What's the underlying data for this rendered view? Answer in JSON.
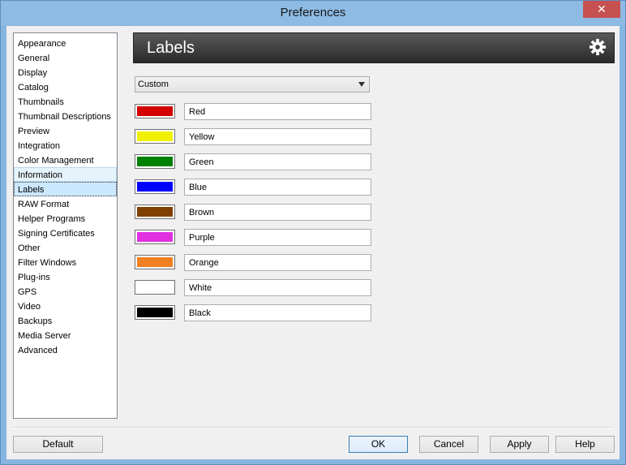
{
  "window": {
    "title": "Preferences",
    "close_label": "✕"
  },
  "sidebar": {
    "items": [
      {
        "label": "Appearance"
      },
      {
        "label": "General"
      },
      {
        "label": "Display"
      },
      {
        "label": "Catalog"
      },
      {
        "label": "Thumbnails"
      },
      {
        "label": "Thumbnail Descriptions"
      },
      {
        "label": "Preview"
      },
      {
        "label": "Integration"
      },
      {
        "label": "Color Management"
      },
      {
        "label": "Information"
      },
      {
        "label": "Labels"
      },
      {
        "label": "RAW Format"
      },
      {
        "label": "Helper Programs"
      },
      {
        "label": "Signing Certificates"
      },
      {
        "label": "Other"
      },
      {
        "label": "Filter Windows"
      },
      {
        "label": "Plug-ins"
      },
      {
        "label": "GPS"
      },
      {
        "label": "Video"
      },
      {
        "label": "Backups"
      },
      {
        "label": "Media Server"
      },
      {
        "label": "Advanced"
      }
    ],
    "selected": "Labels",
    "hovered": "Information"
  },
  "panel": {
    "title": "Labels",
    "icon": "gear-icon",
    "preset": {
      "selected": "Custom"
    },
    "labels": [
      {
        "name": "Red",
        "color": "#d40000"
      },
      {
        "name": "Yellow",
        "color": "#f0f000"
      },
      {
        "name": "Green",
        "color": "#008000"
      },
      {
        "name": "Blue",
        "color": "#0000ff"
      },
      {
        "name": "Brown",
        "color": "#804000"
      },
      {
        "name": "Purple",
        "color": "#e030e0"
      },
      {
        "name": "Orange",
        "color": "#f08020"
      },
      {
        "name": "White",
        "color": "#ffffff"
      },
      {
        "name": "Black",
        "color": "#000000"
      }
    ]
  },
  "buttons": {
    "default_label": "Default",
    "ok_label": "OK",
    "cancel_label": "Cancel",
    "apply_label": "Apply",
    "help_label": "Help"
  }
}
